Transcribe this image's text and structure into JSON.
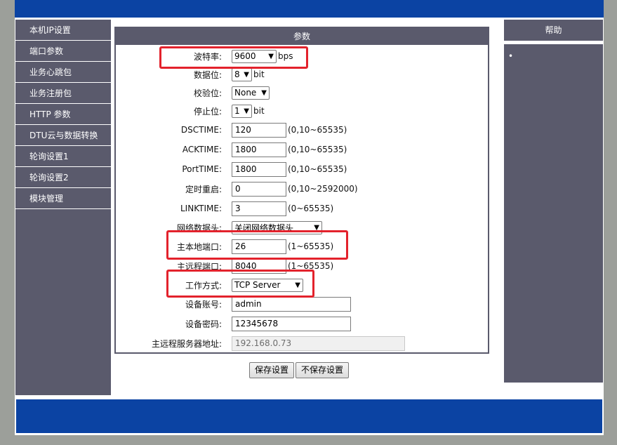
{
  "sidebar": {
    "items": [
      {
        "label": "本机IP设置"
      },
      {
        "label": "端口参数"
      },
      {
        "label": "业务心跳包"
      },
      {
        "label": "业务注册包"
      },
      {
        "label": "HTTP 参数"
      },
      {
        "label": "DTU云与数据转换"
      },
      {
        "label": "轮询设置1"
      },
      {
        "label": "轮询设置2"
      },
      {
        "label": "模块管理"
      }
    ]
  },
  "panel": {
    "title": "参数",
    "baud": {
      "label": "波特率:",
      "value": "9600",
      "unit": "bps"
    },
    "databits": {
      "label": "数据位:",
      "value": "8",
      "unit": "bit"
    },
    "parity": {
      "label": "校验位:",
      "value": "None"
    },
    "stopbits": {
      "label": "停止位:",
      "value": "1",
      "unit": "bit"
    },
    "dsctime": {
      "label": "DSCTIME:",
      "value": "120",
      "range": "(0,10~65535)"
    },
    "acktime": {
      "label": "ACKTIME:",
      "value": "1800",
      "range": "(0,10~65535)"
    },
    "porttime": {
      "label": "PortTIME:",
      "value": "1800",
      "range": "(0,10~65535)"
    },
    "restart": {
      "label": "定时重启:",
      "value": "0",
      "range": "(0,10~2592000)"
    },
    "linktime": {
      "label": "LINKTIME:",
      "value": "3",
      "range": "(0~65535)"
    },
    "netheader": {
      "label": "网络数据头:",
      "value": "关闭网络数据头"
    },
    "localport": {
      "label": "主本地端口:",
      "value": "26",
      "range": "(1~65535)"
    },
    "remoteport": {
      "label": "主远程端口:",
      "value": "8040",
      "range": "(1~65535)"
    },
    "workmode": {
      "label": "工作方式:",
      "value": "TCP Server"
    },
    "account": {
      "label": "设备账号:",
      "value": "admin"
    },
    "password": {
      "label": "设备密码:",
      "value": "12345678"
    },
    "serveraddr": {
      "label": "主远程服务器地址:",
      "value": "192.168.0.73"
    }
  },
  "buttons": {
    "save": "保存设置",
    "nosave": "不保存设置"
  },
  "help": {
    "title": "帮助",
    "bullet": "•"
  },
  "colors": {
    "brand_blue": "#0b43a3",
    "nav_gray": "#5a5a6c",
    "highlight_red": "#e3222c"
  }
}
